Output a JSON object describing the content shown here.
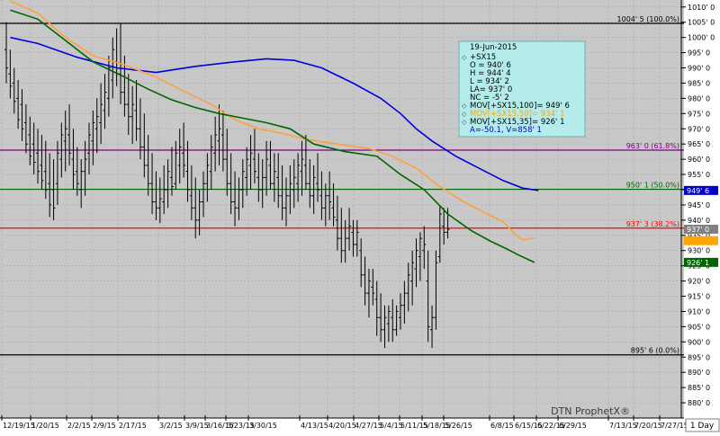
{
  "chart_data": {
    "type": "ohlc-bar",
    "title": "",
    "xlabel": "",
    "ylabel": "",
    "ylim": [
      875,
      1012
    ],
    "grid": true,
    "watermark": "DTN ProphetX®",
    "timeframe_label": "1 Day",
    "x_tick_labels": [
      "12/19/15",
      "1/20/15",
      "2/2/15",
      "2/9/15",
      "2/17/15",
      "3/2/15",
      "3/9/15",
      "3/16/15",
      "3/23/15",
      "3/30/15",
      "4/13/15",
      "4/20/15",
      "4/27/15",
      "5/4/15",
      "5/11/15",
      "5/18/15",
      "5/26/15",
      "6/8/15",
      "6/15/15",
      "6/22/15",
      "6/29/15",
      "7/13/15",
      "7/20/15",
      "7/27/15"
    ],
    "y_ticks": [
      "1010' 0",
      "1005' 0",
      "1000' 0",
      "995' 0",
      "990' 0",
      "985' 0",
      "980' 0",
      "975' 0",
      "970' 0",
      "965' 0",
      "960' 0",
      "955' 0",
      "950' 0",
      "945' 0",
      "940' 0",
      "935' 0",
      "930' 0",
      "925' 0",
      "920' 0",
      "915' 0",
      "910' 0",
      "905' 0",
      "900' 0",
      "895' 0",
      "890' 0",
      "885' 0",
      "880' 0"
    ],
    "fib_levels": [
      {
        "label": "1004' 5 (100.0%)",
        "value": 1004.625,
        "color": "#000000"
      },
      {
        "label": "963' 0 (61.8%)",
        "value": 963.0,
        "color": "#800080"
      },
      {
        "label": "950' 1 (50.0%)",
        "value": 950.125,
        "color": "#006400"
      },
      {
        "label": "937' 3 (38.2%)",
        "value": 937.375,
        "color": "#ff0000"
      },
      {
        "label": "895' 6 (0.0%)",
        "value": 895.75,
        "color": "#000000"
      }
    ],
    "price_badges": [
      {
        "label": "949' 6",
        "value": 949.75,
        "bg": "#0000cc",
        "fg": "#ffffff"
      },
      {
        "label": "937' 0",
        "value": 937.0,
        "bg": "#808080",
        "fg": "#ffffff"
      },
      {
        "label": "926' 1",
        "value": 926.125,
        "bg": "#006400",
        "fg": "#ffffff"
      }
    ],
    "highlight_badge": {
      "value": 933.25,
      "color": "#ffa500"
    },
    "moving_averages": [
      {
        "name": "MOV[+SX15,100]",
        "color": "#0000dd",
        "points": [
          [
            1,
            1000.0
          ],
          [
            8,
            998.0
          ],
          [
            18,
            993.5
          ],
          [
            28,
            990.0
          ],
          [
            38,
            988.5
          ],
          [
            48,
            990.5
          ],
          [
            58,
            992.0
          ],
          [
            66,
            993.0
          ],
          [
            73,
            992.5
          ],
          [
            80,
            990.0
          ],
          [
            88,
            985.0
          ],
          [
            95,
            980.0
          ],
          [
            100,
            975.0
          ],
          [
            104,
            970.0
          ],
          [
            108,
            966.0
          ],
          [
            114,
            961.0
          ],
          [
            120,
            957.0
          ],
          [
            126,
            953.0
          ],
          [
            131,
            950.5
          ],
          [
            135,
            949.75
          ]
        ]
      },
      {
        "name": "MOV[+SX15,50]",
        "color": "#ffa040",
        "points": [
          [
            1,
            1012.0
          ],
          [
            8,
            1008.0
          ],
          [
            15,
            1000.0
          ],
          [
            22,
            994.0
          ],
          [
            30,
            991.0
          ],
          [
            38,
            987.0
          ],
          [
            44,
            983.0
          ],
          [
            52,
            978.0
          ],
          [
            58,
            973.0
          ],
          [
            64,
            970.0
          ],
          [
            70,
            968.5
          ],
          [
            76,
            966.5
          ],
          [
            84,
            965.0
          ],
          [
            92,
            963.5
          ],
          [
            98,
            961.0
          ],
          [
            104,
            957.0
          ],
          [
            110,
            951.0
          ],
          [
            116,
            946.0
          ],
          [
            122,
            942.0
          ],
          [
            126,
            939.5
          ],
          [
            129,
            935.5
          ],
          [
            131,
            933.5
          ],
          [
            134,
            934.1
          ]
        ]
      },
      {
        "name": "MOV[+SX15,35]",
        "color": "#006400",
        "points": [
          [
            1,
            1009.0
          ],
          [
            8,
            1006.0
          ],
          [
            15,
            999.0
          ],
          [
            22,
            992.0
          ],
          [
            30,
            987.0
          ],
          [
            36,
            983.0
          ],
          [
            42,
            979.5
          ],
          [
            48,
            977.0
          ],
          [
            54,
            975.0
          ],
          [
            60,
            973.5
          ],
          [
            66,
            972.0
          ],
          [
            72,
            970.0
          ],
          [
            78,
            965.0
          ],
          [
            86,
            962.5
          ],
          [
            94,
            961.0
          ],
          [
            100,
            955.0
          ],
          [
            106,
            950.0
          ],
          [
            112,
            942.0
          ],
          [
            118,
            936.5
          ],
          [
            123,
            933.0
          ],
          [
            127,
            930.5
          ],
          [
            130,
            928.5
          ],
          [
            134,
            926.1
          ]
        ]
      }
    ],
    "bars": [
      [
        996,
        1005,
        985,
        990
      ],
      [
        988,
        996,
        980,
        984
      ],
      [
        985,
        990,
        975,
        979
      ],
      [
        980,
        986,
        970,
        973
      ],
      [
        978,
        983,
        966,
        970
      ],
      [
        972,
        978,
        962,
        965
      ],
      [
        968,
        974,
        958,
        961
      ],
      [
        965,
        972,
        955,
        959
      ],
      [
        962,
        970,
        952,
        956
      ],
      [
        958,
        968,
        950,
        953
      ],
      [
        956,
        966,
        947,
        950
      ],
      [
        952,
        962,
        941,
        945
      ],
      [
        950,
        960,
        940,
        944
      ],
      [
        952,
        966,
        945,
        962
      ],
      [
        960,
        972,
        954,
        968
      ],
      [
        966,
        976,
        956,
        970
      ],
      [
        968,
        978,
        958,
        962
      ],
      [
        960,
        970,
        950,
        955
      ],
      [
        956,
        964,
        948,
        952
      ],
      [
        950,
        960,
        944,
        956
      ],
      [
        956,
        966,
        948,
        960
      ],
      [
        962,
        972,
        955,
        968
      ],
      [
        966,
        976,
        958,
        972
      ],
      [
        970,
        980,
        962,
        974
      ],
      [
        972,
        985,
        965,
        978
      ],
      [
        976,
        988,
        970,
        982
      ],
      [
        980,
        994,
        974,
        990
      ],
      [
        986,
        1000,
        980,
        996
      ],
      [
        992,
        1003,
        984,
        988
      ],
      [
        988,
        1004.6,
        978,
        982
      ],
      [
        982,
        994,
        974,
        978
      ],
      [
        978,
        988,
        968,
        974
      ],
      [
        974,
        984,
        965,
        978
      ],
      [
        976,
        986,
        966,
        970
      ],
      [
        970,
        980,
        960,
        964
      ],
      [
        964,
        975,
        954,
        958
      ],
      [
        958,
        968,
        948,
        952
      ],
      [
        952,
        962,
        942,
        946
      ],
      [
        946,
        956,
        940,
        944
      ],
      [
        944,
        954,
        939,
        947
      ],
      [
        946,
        958,
        942,
        950
      ],
      [
        950,
        960,
        944,
        956
      ],
      [
        954,
        964,
        948,
        951
      ],
      [
        952,
        966,
        950,
        962
      ],
      [
        958,
        970,
        952,
        964
      ],
      [
        962,
        972,
        954,
        958
      ],
      [
        956,
        966,
        946,
        950
      ],
      [
        948,
        958,
        940,
        944
      ],
      [
        944,
        954,
        934,
        940
      ],
      [
        940,
        950,
        935,
        946
      ],
      [
        946,
        956,
        941,
        952
      ],
      [
        952,
        962,
        946,
        958
      ],
      [
        956,
        968,
        950,
        964
      ],
      [
        962,
        974,
        956,
        968
      ],
      [
        966,
        978,
        958,
        970
      ],
      [
        968,
        976,
        956,
        960
      ],
      [
        960,
        970,
        948,
        952
      ],
      [
        952,
        962,
        942,
        946
      ],
      [
        946,
        956,
        938,
        944
      ],
      [
        944,
        954,
        940,
        950
      ],
      [
        950,
        960,
        944,
        956
      ],
      [
        954,
        964,
        948,
        960
      ],
      [
        958,
        968,
        950,
        962
      ],
      [
        960,
        970,
        952,
        956
      ],
      [
        954,
        962,
        946,
        950
      ],
      [
        950,
        960,
        944,
        954
      ],
      [
        954,
        966,
        948,
        960
      ],
      [
        958,
        966,
        950,
        952
      ],
      [
        952,
        962,
        946,
        956
      ],
      [
        954,
        962,
        944,
        948
      ],
      [
        948,
        958,
        940,
        944
      ],
      [
        944,
        954,
        938,
        948
      ],
      [
        948,
        958,
        942,
        952
      ],
      [
        950,
        960,
        944,
        954
      ],
      [
        952,
        962,
        946,
        958
      ],
      [
        956,
        966,
        948,
        960
      ],
      [
        958,
        968,
        950,
        952
      ],
      [
        952,
        960,
        944,
        948
      ],
      [
        948,
        958,
        942,
        954
      ],
      [
        952,
        962,
        946,
        950
      ],
      [
        948,
        956,
        940,
        944
      ],
      [
        944,
        952,
        938,
        948
      ],
      [
        948,
        956,
        940,
        946
      ],
      [
        944,
        952,
        938,
        941
      ],
      [
        940,
        948,
        930,
        934
      ],
      [
        934,
        944,
        926,
        930
      ],
      [
        930,
        940,
        926,
        934
      ],
      [
        934,
        944,
        930,
        938
      ],
      [
        936,
        940,
        928,
        932
      ],
      [
        932,
        940,
        928,
        936
      ],
      [
        930,
        934,
        918,
        922
      ],
      [
        922,
        928,
        912,
        916
      ],
      [
        916,
        924,
        908,
        920
      ],
      [
        918,
        924,
        912,
        916
      ],
      [
        914,
        920,
        902,
        908
      ],
      [
        908,
        916,
        900,
        904
      ],
      [
        904,
        912,
        898,
        908
      ],
      [
        906,
        912,
        900,
        910
      ],
      [
        908,
        914,
        900,
        904
      ],
      [
        904,
        912,
        902,
        910
      ],
      [
        908,
        916,
        904,
        912
      ],
      [
        912,
        920,
        906,
        916
      ],
      [
        916,
        926,
        910,
        922
      ],
      [
        920,
        930,
        912,
        926
      ],
      [
        924,
        934,
        918,
        930
      ],
      [
        928,
        936,
        920,
        934
      ],
      [
        930,
        938,
        924,
        932
      ],
      [
        920,
        930,
        900,
        905
      ],
      [
        904,
        912,
        898,
        908
      ],
      [
        908,
        930,
        904,
        926
      ],
      [
        928,
        945,
        926,
        942
      ],
      [
        938,
        944,
        932,
        936
      ],
      [
        936,
        944,
        934,
        937
      ]
    ]
  },
  "info_box": {
    "title": "19-Jun-2015",
    "lines": [
      {
        "text": "+SX15",
        "color": "#000000"
      },
      {
        "text": "O = 940' 6",
        "color": "#000000"
      },
      {
        "text": "H = 944' 4",
        "color": "#000000"
      },
      {
        "text": "L = 934' 2",
        "color": "#000000"
      },
      {
        "text": "LA= 937' 0",
        "color": "#000000"
      },
      {
        "text": "NC = -5' 2",
        "color": "#000000"
      },
      {
        "text": "MOV[+SX15,100]= 949' 6",
        "color": "#000000"
      },
      {
        "text": "MOV[+SX15,50]= 934' 1",
        "color": "#ffa500"
      },
      {
        "text": "MOV[+SX15,35]= 926' 1",
        "color": "#000000"
      },
      {
        "text": "A=-50.1, V=858' 1",
        "color": "#0000cc"
      }
    ]
  },
  "colors": {
    "plot_bg": "#c8c8c8",
    "axis_bg": "#ffffff",
    "bar_color": "#000000",
    "grid_color": "#a8a8a8",
    "info_bg": "#b4ecec"
  }
}
